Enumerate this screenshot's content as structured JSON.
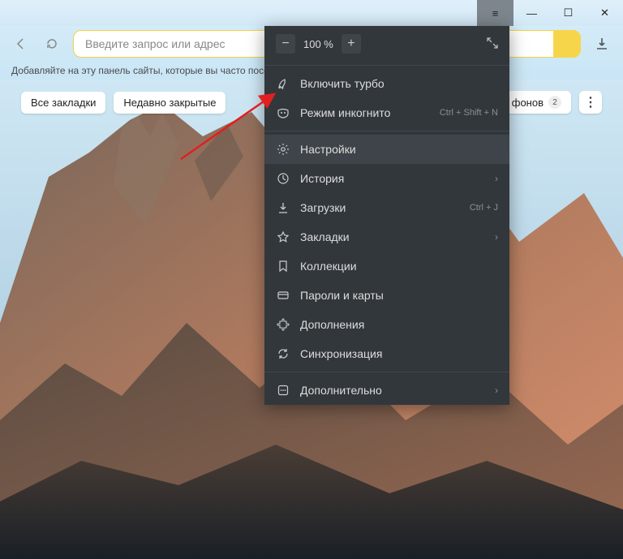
{
  "titlebar": {
    "hamburger": "≡",
    "minimize": "—",
    "maximize": "☐",
    "close": "✕"
  },
  "toolbar": {
    "address_placeholder": "Введите запрос или адрес",
    "download_tooltip": "Загрузки"
  },
  "infobar": {
    "text": "Добавляйте на эту панель сайты, которые вы часто посещ"
  },
  "chips": {
    "all_bookmarks": "Все закладки",
    "recently_closed": "Недавно закрытые",
    "gallery_label": "я фонов",
    "gallery_badge": "2"
  },
  "menu": {
    "zoom_value": "100 %",
    "turbo": "Включить турбо",
    "incognito": "Режим инкогнито",
    "incognito_shortcut": "Ctrl + Shift + N",
    "settings": "Настройки",
    "history": "История",
    "downloads": "Загрузки",
    "downloads_shortcut": "Ctrl + J",
    "bookmarks": "Закладки",
    "collections": "Коллекции",
    "passwords": "Пароли и карты",
    "extensions": "Дополнения",
    "sync": "Синхронизация",
    "more": "Дополнительно"
  }
}
